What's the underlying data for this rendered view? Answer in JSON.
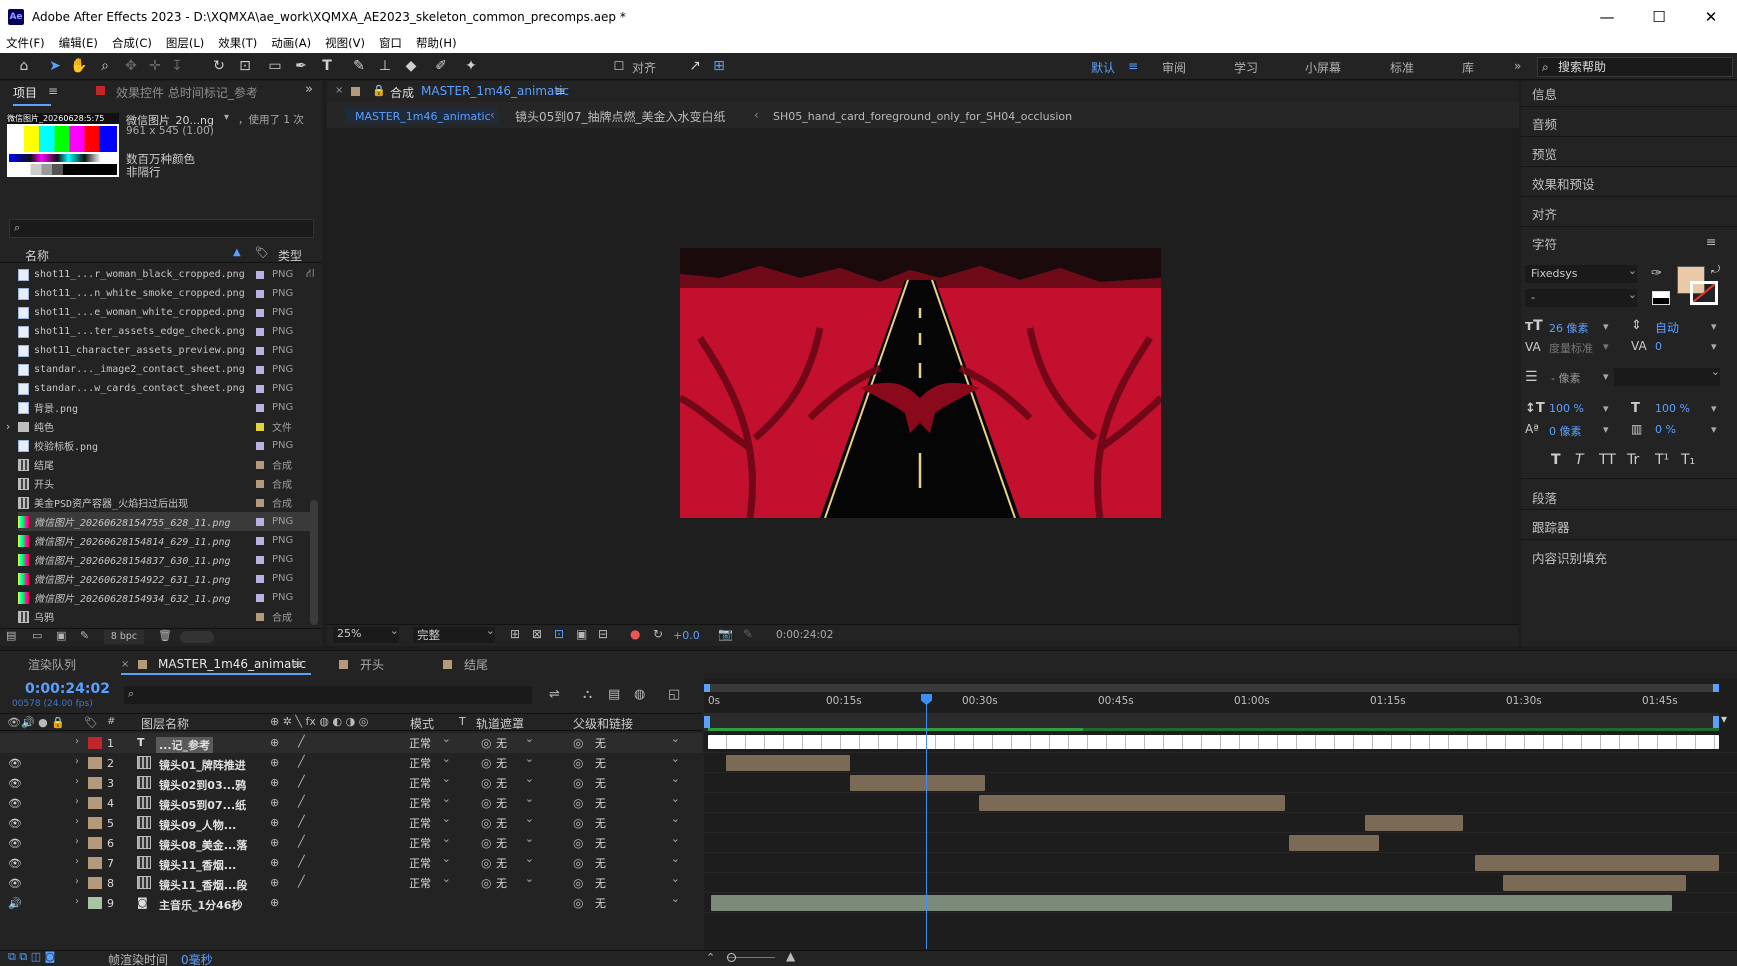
{
  "window": {
    "title": "Adobe After Effects 2023 - D:\\XQMXA\\ae_work\\XQMXA_AE2023_skeleton_common_precomps.aep *",
    "logo": "Ae",
    "controls": [
      "—",
      "☐",
      "✕"
    ]
  },
  "menu": [
    "文件(F)",
    "编辑(E)",
    "合成(C)",
    "图层(L)",
    "效果(T)",
    "动画(A)",
    "视图(V)",
    "窗口",
    "帮助(H)"
  ],
  "toolbar": {
    "align_label": "对齐",
    "workspaces": [
      {
        "label": "默认",
        "active": true
      },
      {
        "label": "审阅",
        "active": false
      },
      {
        "label": "学习",
        "active": false
      },
      {
        "label": "小屏幕",
        "active": false
      },
      {
        "label": "标准",
        "active": false
      },
      {
        "label": "库",
        "active": false
      }
    ],
    "search_placeholder": "搜索帮助"
  },
  "project_panel": {
    "tab_project": "项目",
    "tab_effects": "效果控件 总时间标记_参考",
    "preview": {
      "thumb_label": "微信图片_20260628:5:75",
      "name": "微信图片_20...ng",
      "used": "，使用了 1 次",
      "dims": "961 x 545 (1.00)",
      "colors": "数百万种颜色",
      "interlace": "非隔行"
    },
    "col_name": "名称",
    "col_type": "类型",
    "bpc": "8 bpc",
    "items": [
      {
        "name": "shot11_...r_woman_black_cropped.png",
        "type": "PNG",
        "kind": "file",
        "label": "#b6b3e0"
      },
      {
        "name": "shot11_...n_white_smoke_cropped.png",
        "type": "PNG",
        "kind": "file",
        "label": "#b6b3e0"
      },
      {
        "name": "shot11_...e_woman_white_cropped.png",
        "type": "PNG",
        "kind": "file",
        "label": "#b6b3e0"
      },
      {
        "name": "shot11_...ter_assets_edge_check.png",
        "type": "PNG",
        "kind": "file",
        "label": "#b6b3e0"
      },
      {
        "name": "shot11_character_assets_preview.png",
        "type": "PNG",
        "kind": "file",
        "label": "#b6b3e0"
      },
      {
        "name": "standar..._image2_contact_sheet.png",
        "type": "PNG",
        "kind": "file",
        "label": "#b6b3e0"
      },
      {
        "name": "standar...w_cards_contact_sheet.png",
        "type": "PNG",
        "kind": "file",
        "label": "#b6b3e0"
      },
      {
        "name": "背景.png",
        "type": "PNG",
        "kind": "file",
        "label": "#b6b3e0"
      },
      {
        "name": "纯色",
        "type": "文件",
        "kind": "folder",
        "label": "#e5d33c"
      },
      {
        "name": "校验标板.png",
        "type": "PNG",
        "kind": "file",
        "label": "#b6b3e0"
      },
      {
        "name": "结尾",
        "type": "合成",
        "kind": "comp",
        "label": "#b59a7a"
      },
      {
        "name": "开头",
        "type": "合成",
        "kind": "comp",
        "label": "#b59a7a"
      },
      {
        "name": "美金PSD资产容器_火焰扫过后出现",
        "type": "合成",
        "kind": "comp",
        "label": "#b59a7a"
      },
      {
        "name": "微信图片_20260628154755_628_11.png",
        "type": "PNG",
        "kind": "img",
        "label": "#b6b3e0",
        "selected": true
      },
      {
        "name": "微信图片_20260628154814_629_11.png",
        "type": "PNG",
        "kind": "img",
        "label": "#b6b3e0"
      },
      {
        "name": "微信图片_20260628154837_630_11.png",
        "type": "PNG",
        "kind": "img",
        "label": "#b6b3e0"
      },
      {
        "name": "微信图片_20260628154922_631_11.png",
        "type": "PNG",
        "kind": "img",
        "label": "#b6b3e0"
      },
      {
        "name": "微信图片_20260628154934_632_11.png",
        "type": "PNG",
        "kind": "img",
        "label": "#b6b3e0"
      },
      {
        "name": "乌鸦",
        "type": "合成",
        "kind": "comp",
        "label": "#b59a7a"
      }
    ]
  },
  "composition": {
    "tab_prefix": "合成",
    "tab_name": "MASTER_1m46_animatic",
    "breadcrumbs": [
      "MASTER_1m46_animatic",
      "镜头05到07_抽牌点燃_美金入水变白纸",
      "SH05_hand_card_foreground_only_for_SH04_occlusion"
    ],
    "zoom": "25%",
    "quality": "完整",
    "exposure": "+0.0",
    "timecode": "0:00:24:02"
  },
  "right_panel": {
    "sections": [
      "信息",
      "音频",
      "预览",
      "效果和预设",
      "对齐",
      "字符"
    ],
    "lower_sections": [
      "段落",
      "跟踪器",
      "内容识别填充"
    ],
    "character": {
      "font": "Fixedsys",
      "style": "-",
      "size": "26 像素",
      "leading": "自动",
      "kerning": "度量标准",
      "tracking": "0",
      "stroke": "- 像素",
      "vscale": "100 %",
      "hscale": "100 %",
      "baseline": "0 像素",
      "tsume": "0 %",
      "fill_color": "#e9c9a7",
      "style_buttons": [
        "T",
        "T",
        "TT",
        "Tr",
        "T¹",
        "T₁"
      ]
    }
  },
  "timeline": {
    "tabs": [
      "渲染队列",
      "MASTER_1m46_animatic",
      "开头",
      "结尾"
    ],
    "timecode": "0:00:24:02",
    "frame_info": "00578 (24.00 fps)",
    "headers": {
      "layer_name": "图层名称",
      "mode": "模式",
      "t": "T",
      "track_matte": "轨道遮罩",
      "parent": "父级和链接"
    },
    "ruler": [
      "0s",
      "00:15s",
      "00:30s",
      "00:45s",
      "01:00s",
      "01:15s",
      "01:30s",
      "01:45s"
    ],
    "layers": [
      {
        "num": "1",
        "name": "...记_参考",
        "label": "#c2262b",
        "mode": "正常",
        "matte": "无",
        "parent": "无",
        "type": "text",
        "start": 0.0,
        "end": 1.0
      },
      {
        "num": "2",
        "name": "镜头01_牌阵推进",
        "label": "#b59a7a",
        "mode": "正常",
        "matte": "无",
        "parent": "无",
        "type": "comp",
        "start": 0.018,
        "end": 0.14
      },
      {
        "num": "3",
        "name": "镜头02到03...鸦",
        "label": "#b59a7a",
        "mode": "正常",
        "matte": "无",
        "parent": "无",
        "type": "comp",
        "start": 0.14,
        "end": 0.274
      },
      {
        "num": "4",
        "name": "镜头05到07...纸",
        "label": "#b59a7a",
        "mode": "正常",
        "matte": "无",
        "parent": "无",
        "type": "comp",
        "start": 0.268,
        "end": 0.571
      },
      {
        "num": "5",
        "name": "镜头09_人物...",
        "label": "#b59a7a",
        "mode": "正常",
        "matte": "无",
        "parent": "无",
        "type": "comp",
        "start": 0.65,
        "end": 0.747
      },
      {
        "num": "6",
        "name": "镜头08_美金...落",
        "label": "#b59a7a",
        "mode": "正常",
        "matte": "无",
        "parent": "无",
        "type": "comp",
        "start": 0.575,
        "end": 0.664
      },
      {
        "num": "7",
        "name": "镜头11_香烟...",
        "label": "#b59a7a",
        "mode": "正常",
        "matte": "无",
        "parent": "无",
        "type": "comp",
        "start": 0.759,
        "end": 1.0
      },
      {
        "num": "8",
        "name": "镜头11_香烟...段",
        "label": "#b59a7a",
        "mode": "正常",
        "matte": "无",
        "parent": "无",
        "type": "comp",
        "start": 0.786,
        "end": 0.967
      },
      {
        "num": "9",
        "name": "主音乐_1分46秒",
        "label": "#a9c4a4",
        "mode": "",
        "matte": "",
        "parent": "无",
        "type": "audio",
        "start": 0.003,
        "end": 0.954
      }
    ],
    "footer": {
      "label": "帧渲染时间",
      "value": "0毫秒"
    }
  },
  "colors": {
    "accent": "#5aa0ff",
    "comp_bg": "#c2102e",
    "bar": "#7b6a55",
    "audio_bar": "#7c8a7a"
  }
}
